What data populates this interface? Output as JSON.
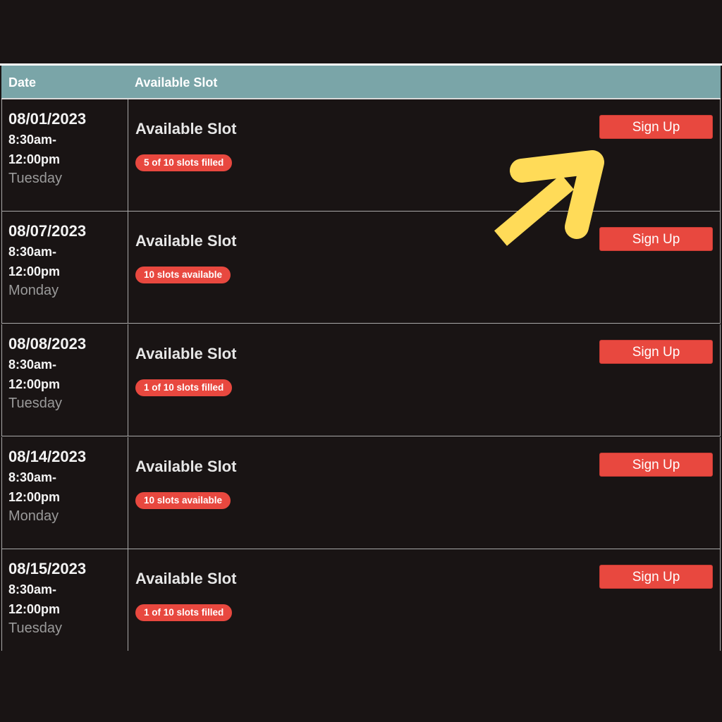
{
  "header": {
    "date_label": "Date",
    "slot_label": "Available Slot"
  },
  "rows": [
    {
      "date": "08/01/2023",
      "time_start": "8:30am-",
      "time_end": "12:00pm",
      "day": "Tuesday",
      "title": "Available Slot",
      "status": "5 of 10 slots filled",
      "button": "Sign Up"
    },
    {
      "date": "08/07/2023",
      "time_start": "8:30am-",
      "time_end": "12:00pm",
      "day": "Monday",
      "title": "Available Slot",
      "status": "10 slots available",
      "button": "Sign Up"
    },
    {
      "date": "08/08/2023",
      "time_start": "8:30am-",
      "time_end": "12:00pm",
      "day": "Tuesday",
      "title": "Available Slot",
      "status": "1 of 10 slots filled",
      "button": "Sign Up"
    },
    {
      "date": "08/14/2023",
      "time_start": "8:30am-",
      "time_end": "12:00pm",
      "day": "Monday",
      "title": "Available Slot",
      "status": "10 slots available",
      "button": "Sign Up"
    },
    {
      "date": "08/15/2023",
      "time_start": "8:30am-",
      "time_end": "12:00pm",
      "day": "Tuesday",
      "title": "Available Slot",
      "status": "1 of 10 slots filled",
      "button": "Sign Up"
    }
  ],
  "colors": {
    "background": "#191414",
    "header": "#7aa5a8",
    "accent": "#e8483f",
    "arrow": "#ffdb58"
  },
  "icons": {
    "annotation": "arrow-up-right-icon"
  }
}
